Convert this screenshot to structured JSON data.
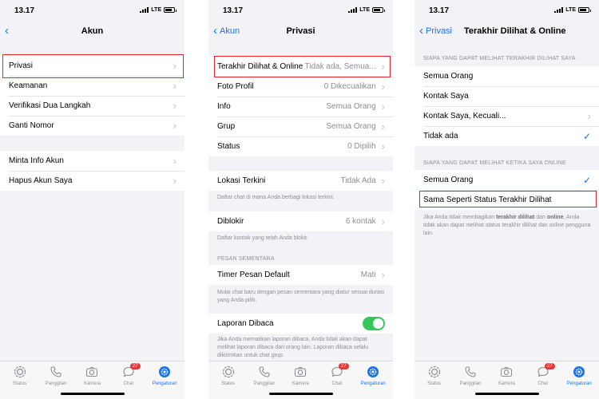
{
  "status": {
    "time": "13.17",
    "network": "LTE"
  },
  "colors": {
    "accent": "#1a73e8",
    "highlight": "#e0262b",
    "toggle_on": "#34c759",
    "badge": "#e53935"
  },
  "tabbar": {
    "items": [
      {
        "label": "Status",
        "icon": "status-icon"
      },
      {
        "label": "Panggilan",
        "icon": "phone-icon"
      },
      {
        "label": "Kamera",
        "icon": "camera-icon"
      },
      {
        "label": "Chat",
        "icon": "chat-icon",
        "badge": "27"
      },
      {
        "label": "Pengaturan",
        "icon": "gear-icon",
        "active": true
      }
    ]
  },
  "screen1": {
    "title": "Akun",
    "group1": [
      "Privasi",
      "Keamanan",
      "Verifikasi Dua Langkah",
      "Ganti Nomor"
    ],
    "group2": [
      "Minta Info Akun",
      "Hapus Akun Saya"
    ]
  },
  "screen2": {
    "back": "Akun",
    "title": "Privasi",
    "group1": [
      {
        "label": "Terakhir Dilihat & Online",
        "value": "Tidak ada, Semua..."
      },
      {
        "label": "Foto Profil",
        "value": "0 Dikecualikan"
      },
      {
        "label": "Info",
        "value": "Semua Orang"
      },
      {
        "label": "Grup",
        "value": "Semua Orang"
      },
      {
        "label": "Status",
        "value": "0 Dipilih"
      }
    ],
    "live_location": {
      "label": "Lokasi Terkini",
      "value": "Tidak Ada",
      "footer": "Daftar chat di mana Anda berbagi lokasi terkini."
    },
    "blocked": {
      "label": "Diblokir",
      "value": "6 kontak",
      "footer": "Daftar kontak yang telah Anda blokir."
    },
    "temp_header": "PESAN SEMENTARA",
    "timer": {
      "label": "Timer Pesan Default",
      "value": "Mati",
      "footer": "Mulai chat baru dengan pesan sementara yang diatur sesuai durasi yang Anda pilih."
    },
    "read_receipts": {
      "label": "Laporan Dibaca",
      "on": true,
      "footer": "Jika Anda mematikan laporan dibaca, Anda tidak akan dapat melihat laporan dibaca dari orang lain. Laporan dibaca selalu dikirimkan untuk chat grup."
    }
  },
  "screen3": {
    "back": "Privasi",
    "title": "Terakhir Dilihat & Online",
    "header1": "SIAPA YANG DAPAT MELIHAT TERAKHIR DILIHAT SAYA",
    "options1": [
      {
        "label": "Semua Orang"
      },
      {
        "label": "Kontak Saya"
      },
      {
        "label": "Kontak Saya, Kecuali...",
        "chevron": true
      },
      {
        "label": "Tidak ada",
        "checked": true
      }
    ],
    "header2": "SIAPA YANG DAPAT MELIHAT KETIKA SAYA ONLINE",
    "options2": [
      {
        "label": "Semua Orang",
        "checked": true
      },
      {
        "label": "Sama Seperti Status Terakhir Dilihat"
      }
    ],
    "footer_parts": {
      "a": "Jika Anda tidak membagikan ",
      "b": "terakhir dilihat",
      "c": " dan ",
      "d": "online",
      "e": ", Anda tidak akan dapat melihat status terakhir dilihat dan online pengguna lain."
    }
  }
}
